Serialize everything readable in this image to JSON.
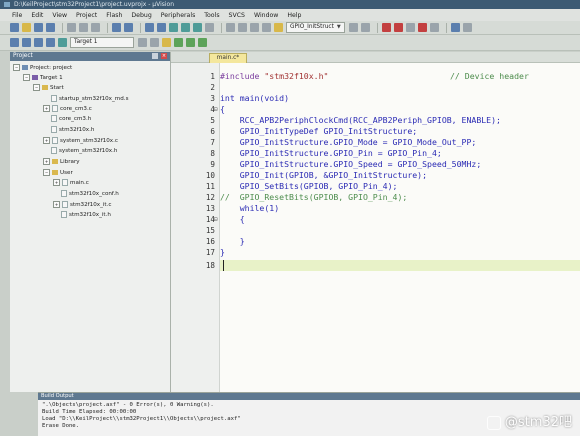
{
  "window": {
    "title": "D:\\KeilProject\\stm32Project1\\project.uvprojx - µVision"
  },
  "menu": [
    "File",
    "Edit",
    "View",
    "Project",
    "Flash",
    "Debug",
    "Peripherals",
    "Tools",
    "SVCS",
    "Window",
    "Help"
  ],
  "toolbar": {
    "function_combo": "GPIO_InitStruct",
    "target_combo": "Target 1"
  },
  "project_pane": {
    "title": "Project",
    "root": "Project: project",
    "target": "Target 1",
    "groups": [
      {
        "name": "Start",
        "files": [
          "startup_stm32f10x_md.s",
          "core_cm3.c",
          "core_cm3.h",
          "stm32f10x.h",
          "system_stm32f10x.c",
          "system_stm32f10x.h"
        ]
      },
      {
        "name": "Library",
        "files": []
      },
      {
        "name": "User",
        "files": [
          "main.c",
          "stm32f10x_conf.h",
          "stm32f10x_it.c",
          "stm32f10x_it.h"
        ]
      }
    ]
  },
  "editor": {
    "tab": "main.c*",
    "lines": [
      {
        "n": "1",
        "text": "#include \"stm32f10x.h\"",
        "comment": "// Device header"
      },
      {
        "n": "2",
        "text": ""
      },
      {
        "n": "3",
        "text": "int main(void)"
      },
      {
        "n": "4",
        "text": "{"
      },
      {
        "n": "5",
        "text": "    RCC_APB2PeriphClockCmd(RCC_APB2Periph_GPIOB, ENABLE);"
      },
      {
        "n": "6",
        "text": "    GPIO_InitTypeDef GPIO_InitStructure;"
      },
      {
        "n": "7",
        "text": "    GPIO_InitStructure.GPIO_Mode = GPIO_Mode_Out_PP;"
      },
      {
        "n": "8",
        "text": "    GPIO_InitStructure.GPIO_Pin = GPIO_Pin_4;"
      },
      {
        "n": "9",
        "text": "    GPIO_InitStructure.GPIO_Speed = GPIO_Speed_50MHz;"
      },
      {
        "n": "10",
        "text": "    GPIO_Init(GPIOB, &GPIO_InitStructure);"
      },
      {
        "n": "11",
        "text": "    GPIO_SetBits(GPIOB, GPIO_Pin_4);"
      },
      {
        "n": "12",
        "text": "//  GPIO_ResetBits(GPIOB, GPIO_Pin_4);"
      },
      {
        "n": "13",
        "text": "    while(1)"
      },
      {
        "n": "14",
        "text": "    {"
      },
      {
        "n": "15",
        "text": ""
      },
      {
        "n": "16",
        "text": "    }"
      },
      {
        "n": "17",
        "text": "}"
      },
      {
        "n": "18",
        "text": ""
      }
    ]
  },
  "build_output": {
    "title": "Build Output",
    "lines": [
      "\".\\Objects\\project.axf\" - 0 Error(s), 0 Warning(s).",
      "Build Time Elapsed:  00:00:00",
      "Load \"D:\\\\KeilProject\\\\stm32Project1\\\\Objects\\\\project.axf\"",
      "Erase Done."
    ]
  },
  "watermark": "@stm32吧"
}
